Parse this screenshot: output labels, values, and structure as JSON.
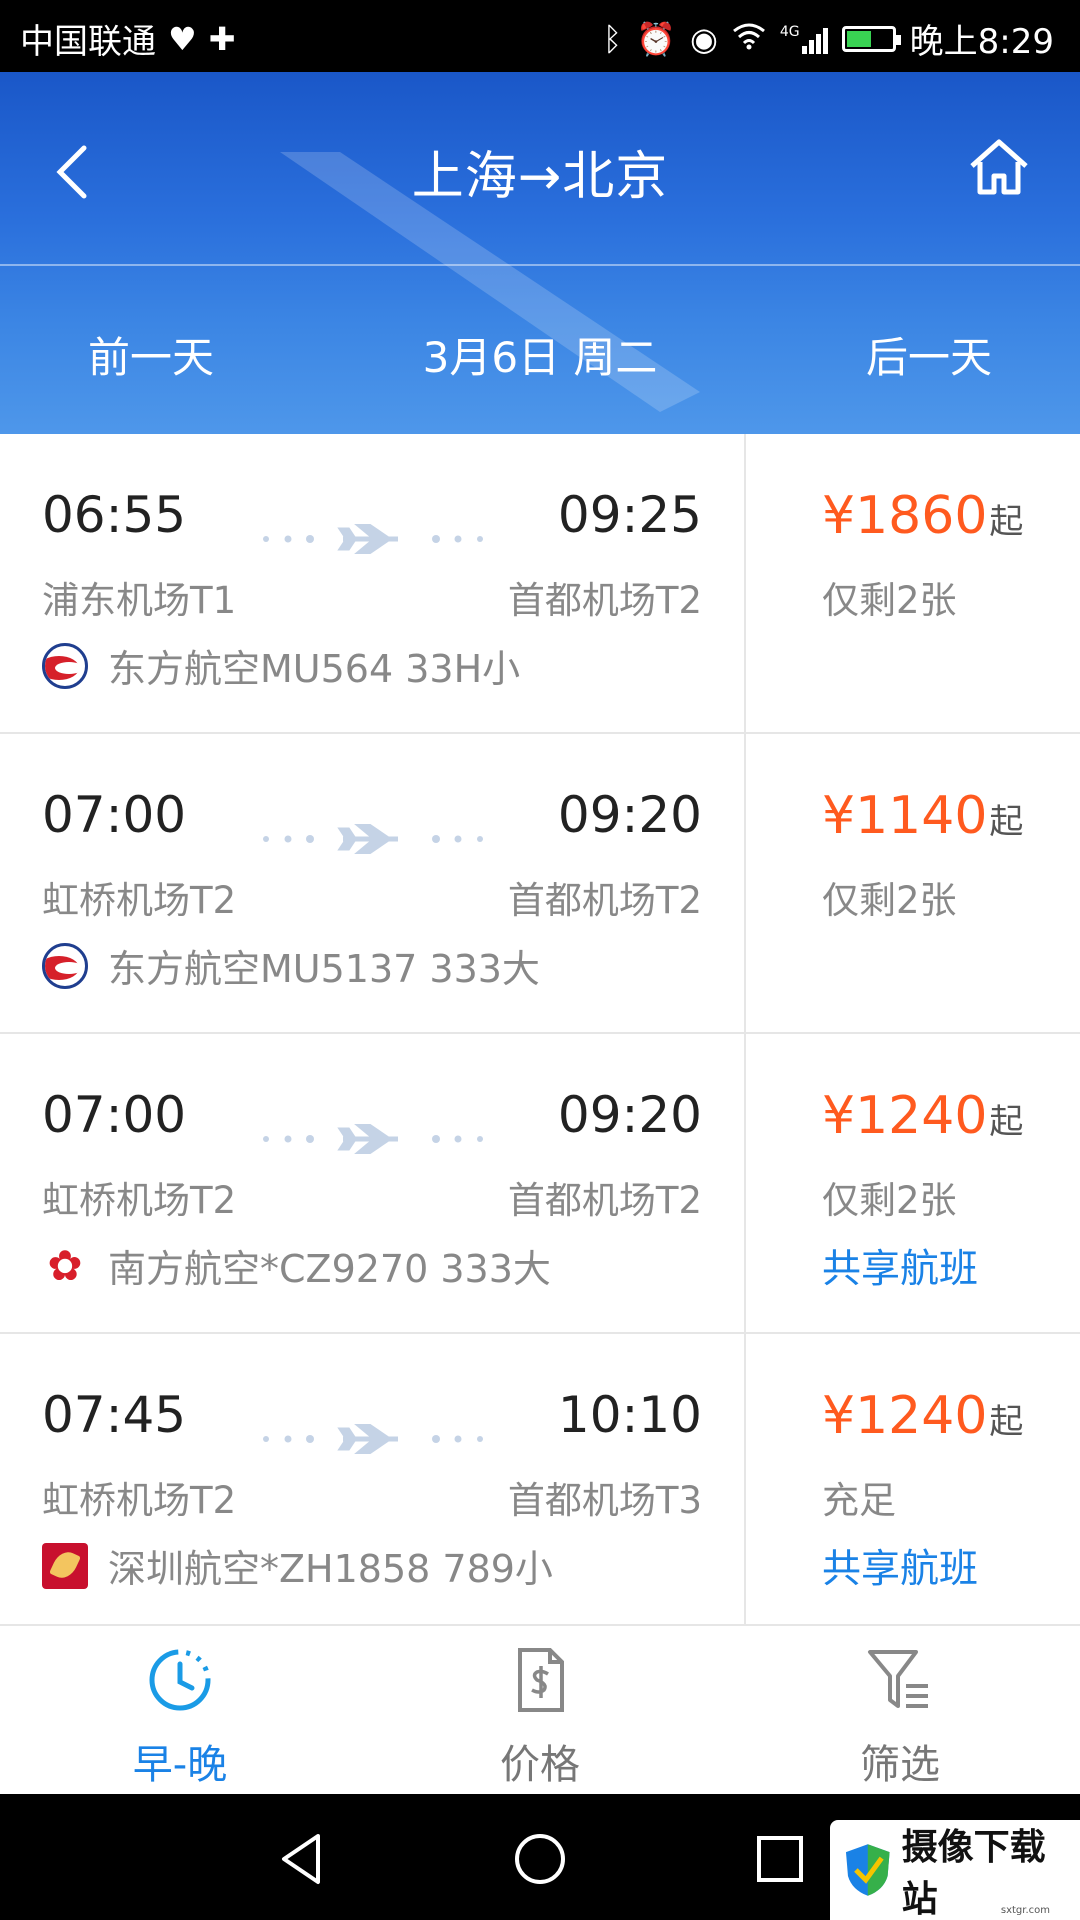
{
  "status_bar": {
    "carrier": "中国联通",
    "time": "晚上8:29",
    "network": "4G"
  },
  "header": {
    "title": "上海→北京",
    "prev_day": "前一天",
    "current_date": "3月6日 周二",
    "next_day": "后一天"
  },
  "flights": [
    {
      "dep_time": "06:55",
      "arr_time": "09:25",
      "dep_airport": "浦东机场T1",
      "arr_airport": "首都机场T2",
      "airline_info": "东方航空MU564 33H小",
      "logo": "china-eastern-logo",
      "price": "¥1860",
      "price_suffix": "起",
      "availability": "仅剩2张",
      "shared": ""
    },
    {
      "dep_time": "07:00",
      "arr_time": "09:20",
      "dep_airport": "虹桥机场T2",
      "arr_airport": "首都机场T2",
      "airline_info": "东方航空MU5137 333大",
      "logo": "china-eastern-logo",
      "price": "¥1140",
      "price_suffix": "起",
      "availability": "仅剩2张",
      "shared": ""
    },
    {
      "dep_time": "07:00",
      "arr_time": "09:20",
      "dep_airport": "虹桥机场T2",
      "arr_airport": "首都机场T2",
      "airline_info": "南方航空*CZ9270 333大",
      "logo": "china-southern-logo",
      "price": "¥1240",
      "price_suffix": "起",
      "availability": "仅剩2张",
      "shared": "共享航班"
    },
    {
      "dep_time": "07:45",
      "arr_time": "10:10",
      "dep_airport": "虹桥机场T2",
      "arr_airport": "首都机场T3",
      "airline_info": "深圳航空*ZH1858 789小",
      "logo": "shenzhen-airlines-logo",
      "price": "¥1240",
      "price_suffix": "起",
      "availability": "充足",
      "shared": "共享航班"
    }
  ],
  "tab_bar": {
    "tabs": [
      {
        "label": "早-晚",
        "icon": "clock-icon",
        "active": true
      },
      {
        "label": "价格",
        "icon": "price-doc-icon",
        "active": false
      },
      {
        "label": "筛选",
        "icon": "filter-icon",
        "active": false
      }
    ]
  },
  "watermark": {
    "text": "摄像下载站",
    "sub": "sxtgr.com"
  },
  "colors": {
    "header_blue": "#2a6fdc",
    "price_orange": "#ff5a1f",
    "link_blue": "#1a82e6"
  }
}
